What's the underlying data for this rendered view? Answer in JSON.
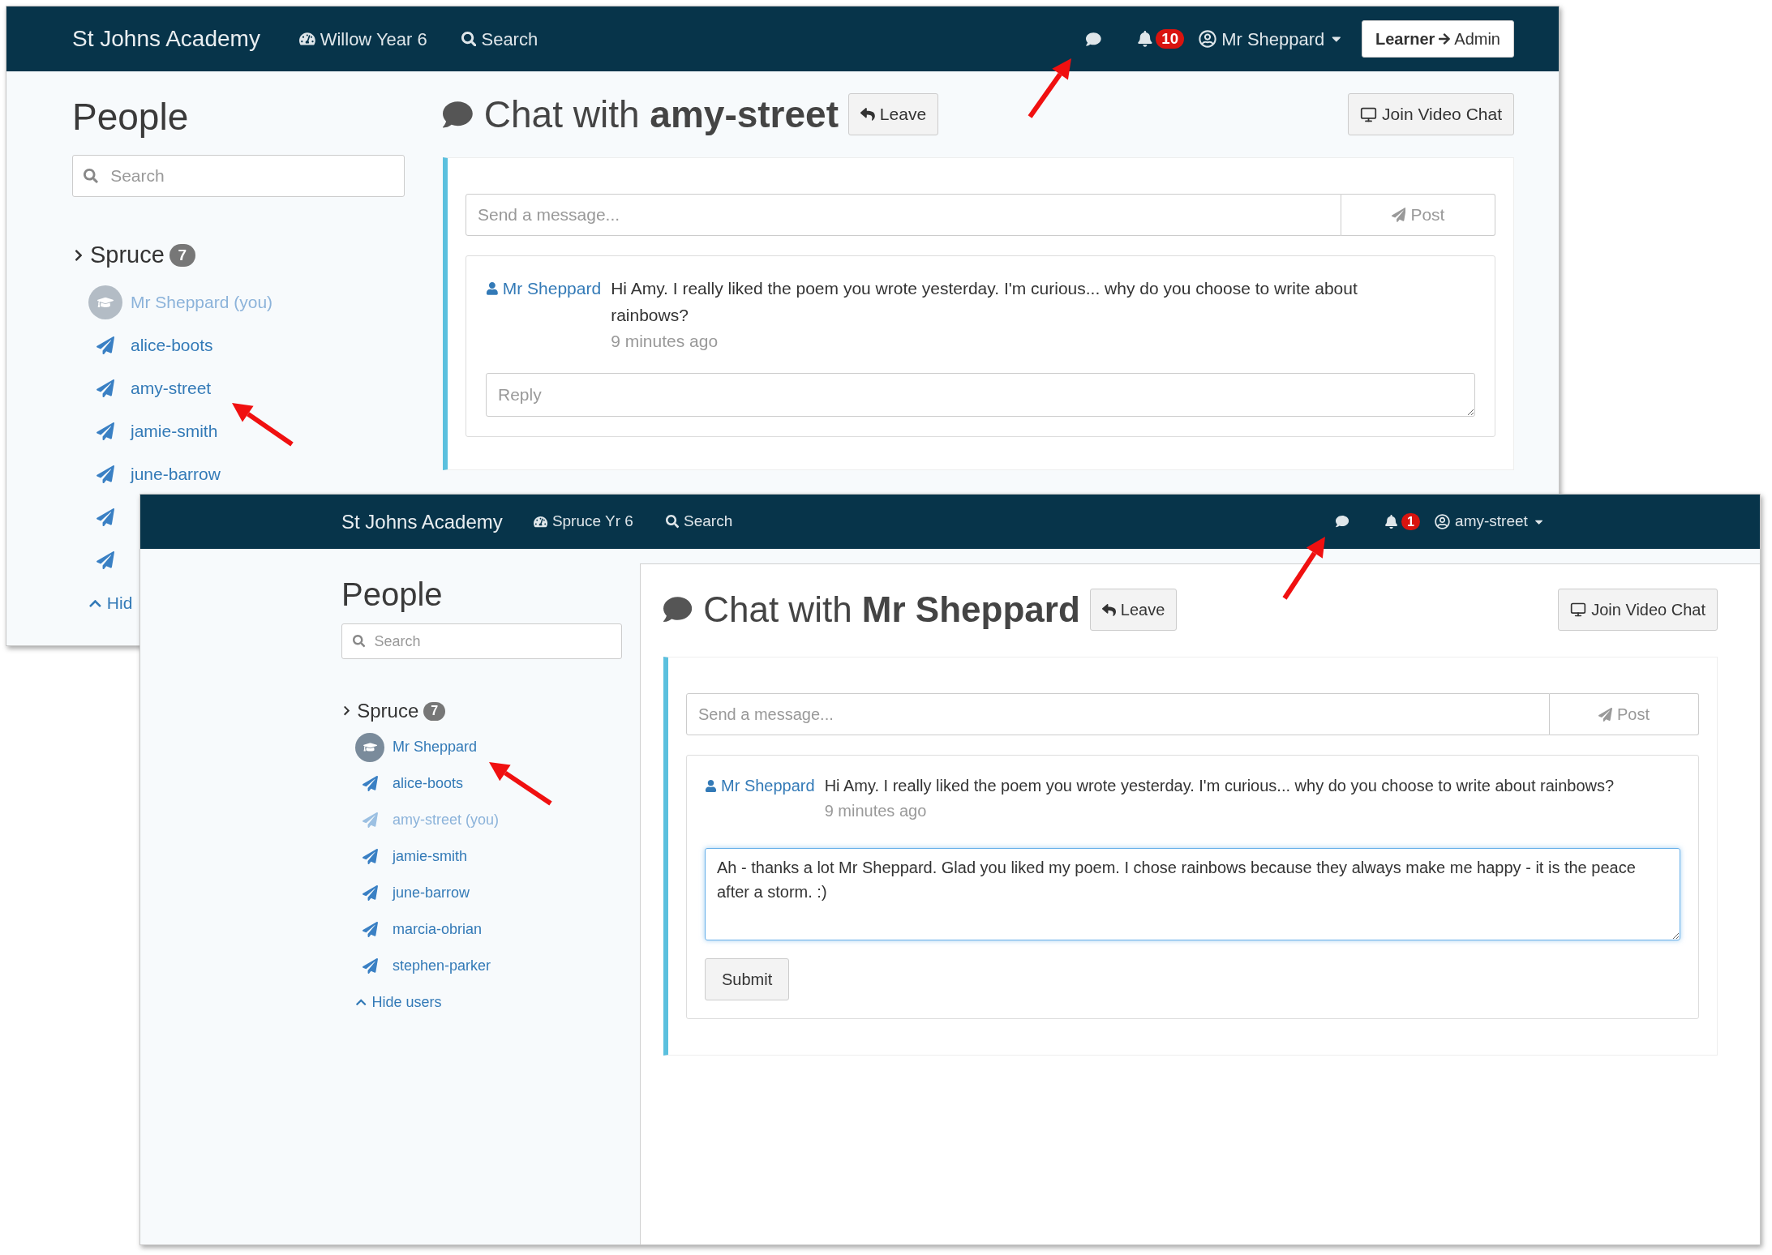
{
  "windows": [
    {
      "navbar": {
        "brand": "St Johns Academy",
        "class_link": "Willow Year 6",
        "search_link": "Search",
        "notification_count": "10",
        "user": "Mr Sheppard",
        "switch_button": {
          "from": "Learner",
          "to": "Admin"
        }
      },
      "sidebar": {
        "title": "People",
        "search": {
          "placeholder": "Search"
        },
        "group": {
          "name": "Spruce",
          "count": "7"
        },
        "users": [
          {
            "kind": "teacher",
            "name": "Mr Sheppard (you)",
            "current_user": true
          },
          {
            "kind": "student",
            "name": "alice-boots",
            "current_user": false
          },
          {
            "kind": "student",
            "name": "amy-street",
            "current_user": false
          },
          {
            "kind": "student",
            "name": "jamie-smith",
            "current_user": false
          },
          {
            "kind": "student",
            "name": "june-barrow",
            "current_user": false
          },
          {
            "kind": "student",
            "current_user": false
          },
          {
            "kind": "student",
            "current_user": false
          }
        ],
        "hide_link": "Hid"
      },
      "chat": {
        "title": "Chat with",
        "partner": "amy-street",
        "leave_button": "Leave",
        "video_button": "Join Video Chat",
        "composer": {
          "placeholder": "Send a message...",
          "button": "Post"
        },
        "messages": [
          {
            "author": "Mr Sheppard",
            "text": "Hi Amy. I really liked the poem you wrote yesterday. I'm curious... why do you choose to write about rainbows?",
            "time": "9 minutes ago",
            "reply": {
              "placeholder": "Reply"
            }
          }
        ]
      }
    },
    {
      "navbar": {
        "brand": "St Johns Academy",
        "class_link": "Spruce Yr 6",
        "search_link": "Search",
        "notification_count": "1",
        "user": "amy-street"
      },
      "sidebar": {
        "title": "People",
        "search": {
          "placeholder": "Search"
        },
        "group": {
          "name": "Spruce",
          "count": "7"
        },
        "users": [
          {
            "kind": "teacher",
            "name": "Mr Sheppard",
            "current_user": false
          },
          {
            "kind": "student",
            "name": "alice-boots",
            "current_user": false
          },
          {
            "kind": "student",
            "name": "amy-street (you)",
            "current_user": true
          },
          {
            "kind": "student",
            "name": "jamie-smith",
            "current_user": false
          },
          {
            "kind": "student",
            "name": "june-barrow",
            "current_user": false
          },
          {
            "kind": "student",
            "name": "marcia-obrian",
            "current_user": false
          },
          {
            "kind": "student",
            "name": "stephen-parker",
            "current_user": false
          }
        ],
        "hide_link": "Hide users"
      },
      "chat": {
        "title": "Chat with",
        "partner": "Mr Sheppard",
        "leave_button": "Leave",
        "video_button": "Join Video Chat",
        "composer": {
          "placeholder": "Send a message...",
          "button": "Post"
        },
        "messages": [
          {
            "author": "Mr Sheppard",
            "text": "Hi Amy. I really liked the poem you wrote yesterday. I'm curious... why do you choose to write about rainbows?",
            "time": "9 minutes ago",
            "reply": {
              "value": "Ah - thanks a lot Mr Sheppard. Glad you liked my poem. I chose rainbows because they always make me happy - it is the peace after a storm. :)",
              "submit_button": "Submit"
            }
          }
        ]
      }
    }
  ]
}
